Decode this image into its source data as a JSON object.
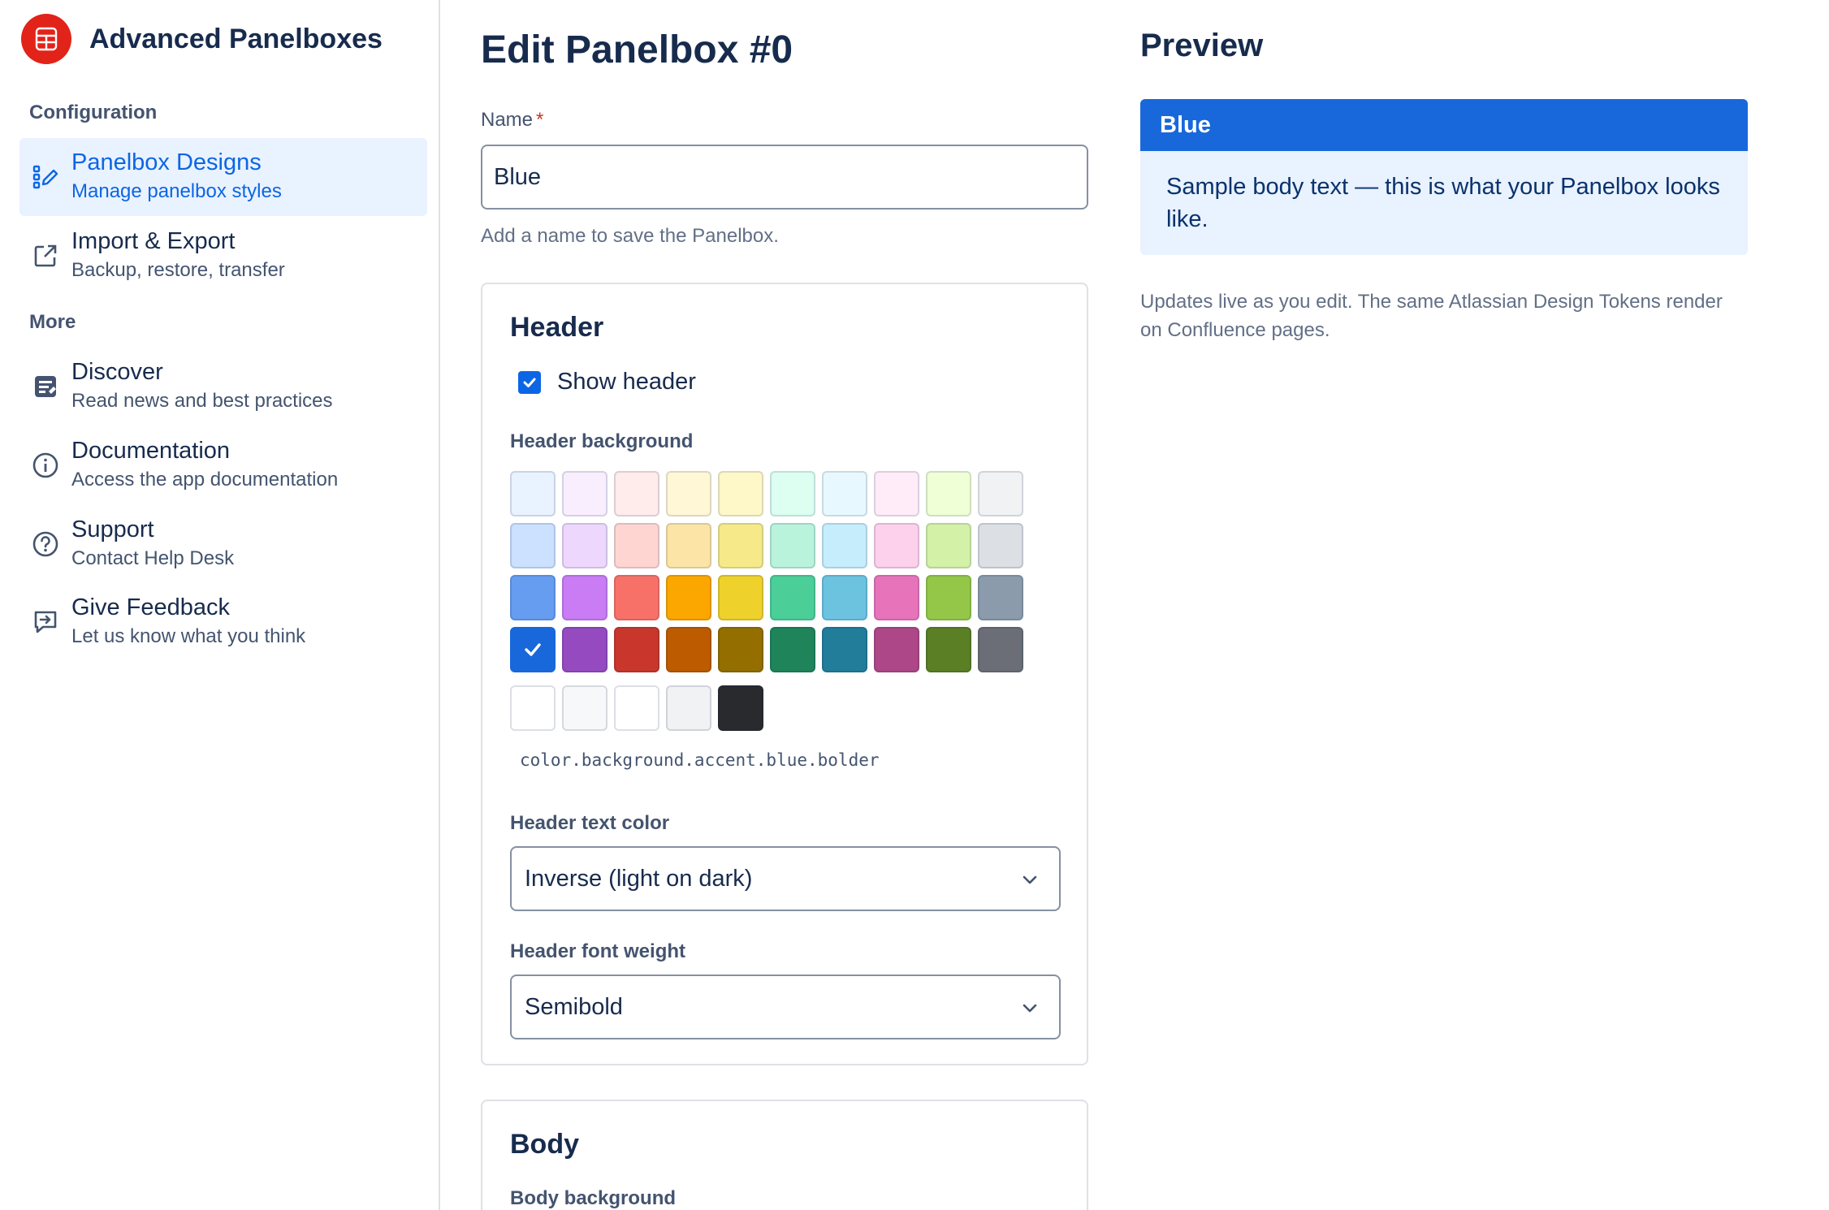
{
  "app": {
    "name": "Advanced Panelboxes"
  },
  "sidebar": {
    "sections": [
      {
        "label": "Configuration"
      },
      {
        "label": "More"
      }
    ],
    "items": [
      {
        "title": "Panelbox Designs",
        "subtitle": "Manage panelbox styles",
        "icon": "design-pencil-icon",
        "active": true
      },
      {
        "title": "Import & Export",
        "subtitle": "Backup, restore, transfer",
        "icon": "external-link-icon"
      },
      {
        "title": "Discover",
        "subtitle": "Read news and best practices",
        "icon": "news-icon"
      },
      {
        "title": "Documentation",
        "subtitle": "Access the app documentation",
        "icon": "info-icon"
      },
      {
        "title": "Support",
        "subtitle": "Contact Help Desk",
        "icon": "question-icon"
      },
      {
        "title": "Give Feedback",
        "subtitle": "Let us know what you think",
        "icon": "feedback-icon"
      }
    ]
  },
  "editor": {
    "title": "Edit Panelbox #0",
    "name_label": "Name",
    "name_required": "*",
    "name_value": "Blue",
    "name_help": "Add a name to save the Panelbox.",
    "header_card": {
      "title": "Header",
      "show_header_label": "Show header",
      "show_header_checked": true,
      "background_label": "Header background",
      "palette_rows": [
        [
          "#e9f2ff",
          "#f8eefe",
          "#ffeceb",
          "#fff7d6",
          "#fef7c8",
          "#dcfff1",
          "#e7f9ff",
          "#ffecf8",
          "#efffd6",
          "#f1f2f4"
        ],
        [
          "#cce0ff",
          "#eed7fc",
          "#ffd5d2",
          "#fce4a6",
          "#f5e989",
          "#baf3db",
          "#c6edfb",
          "#fdd0ec",
          "#d3f1a7",
          "#dcdfe4"
        ],
        [
          "#669df1",
          "#c97cf4",
          "#f87168",
          "#fca700",
          "#eed12b",
          "#4bce97",
          "#6cc3e0",
          "#e774bb",
          "#94c748",
          "#8c9bab"
        ],
        [
          "#1868db",
          "#964ac0",
          "#c9372c",
          "#bd5b00",
          "#946f00",
          "#1f845a",
          "#227d9b",
          "#ae4787",
          "#5b7f24",
          "#6b6e76"
        ],
        [
          "#ffffff",
          "#f7f8f9",
          "#ffffff",
          "#f1f2f4",
          "#292a2e"
        ]
      ],
      "selected_swatch": "#1868db",
      "token": "color.background.accent.blue.bolder",
      "text_color_label": "Header text color",
      "text_color_value": "Inverse (light on dark)",
      "font_weight_label": "Header font weight",
      "font_weight_value": "Semibold"
    },
    "body_card": {
      "title": "Body",
      "background_label": "Body background"
    }
  },
  "preview": {
    "title": "Preview",
    "panel_header": "Blue",
    "panel_body": "Sample body text — this is what your Panelbox looks like.",
    "header_color": "#1868db",
    "body_color": "#e9f2ff",
    "note": "Updates live as you edit. The same Atlassian Design Tokens render on Confluence pages."
  }
}
